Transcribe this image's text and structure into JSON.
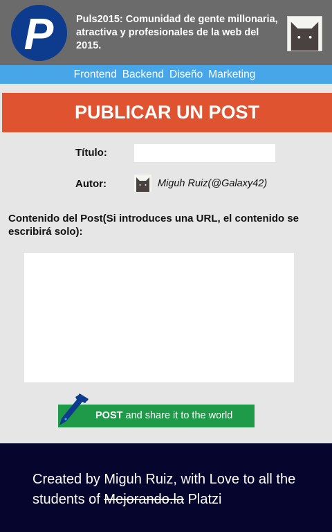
{
  "header": {
    "logo_letter": "P",
    "title": "Puls2015: Comunidad de gente millonaria, atractiva y profesionales de la web del 2015.",
    "avatar_icon": "cat-avatar-icon"
  },
  "nav": {
    "items": [
      {
        "label": "Frontend"
      },
      {
        "label": "Backend"
      },
      {
        "label": "Diseño"
      },
      {
        "label": "Marketing"
      }
    ]
  },
  "banner": {
    "title": "PUBLICAR UN POST"
  },
  "form": {
    "title_label": "Título:",
    "title_value": "",
    "author_label": "Autor:",
    "author_name": "Miguh Ruiz(@Galaxy42)",
    "content_label": "Contenido del Post(Si introduces una URL, el contenido se escribirá solo):",
    "content_value": ""
  },
  "post_button": {
    "strong": "POST",
    "rest": " and share it to the world",
    "icon": "fountain-pen-icon"
  },
  "footer": {
    "line_start": "Created by Miguh Ruiz, with Love to all the students of ",
    "struck": "Mejorando.la",
    "line_end": " Platzi"
  },
  "colors": {
    "header_bg": "#6b6b6b",
    "nav_bg": "#47a6e8",
    "banner_bg": "#e05330",
    "button_bg": "#1f9a48",
    "footer_bg": "#05052e",
    "page_bg": "#e6e6e6"
  }
}
